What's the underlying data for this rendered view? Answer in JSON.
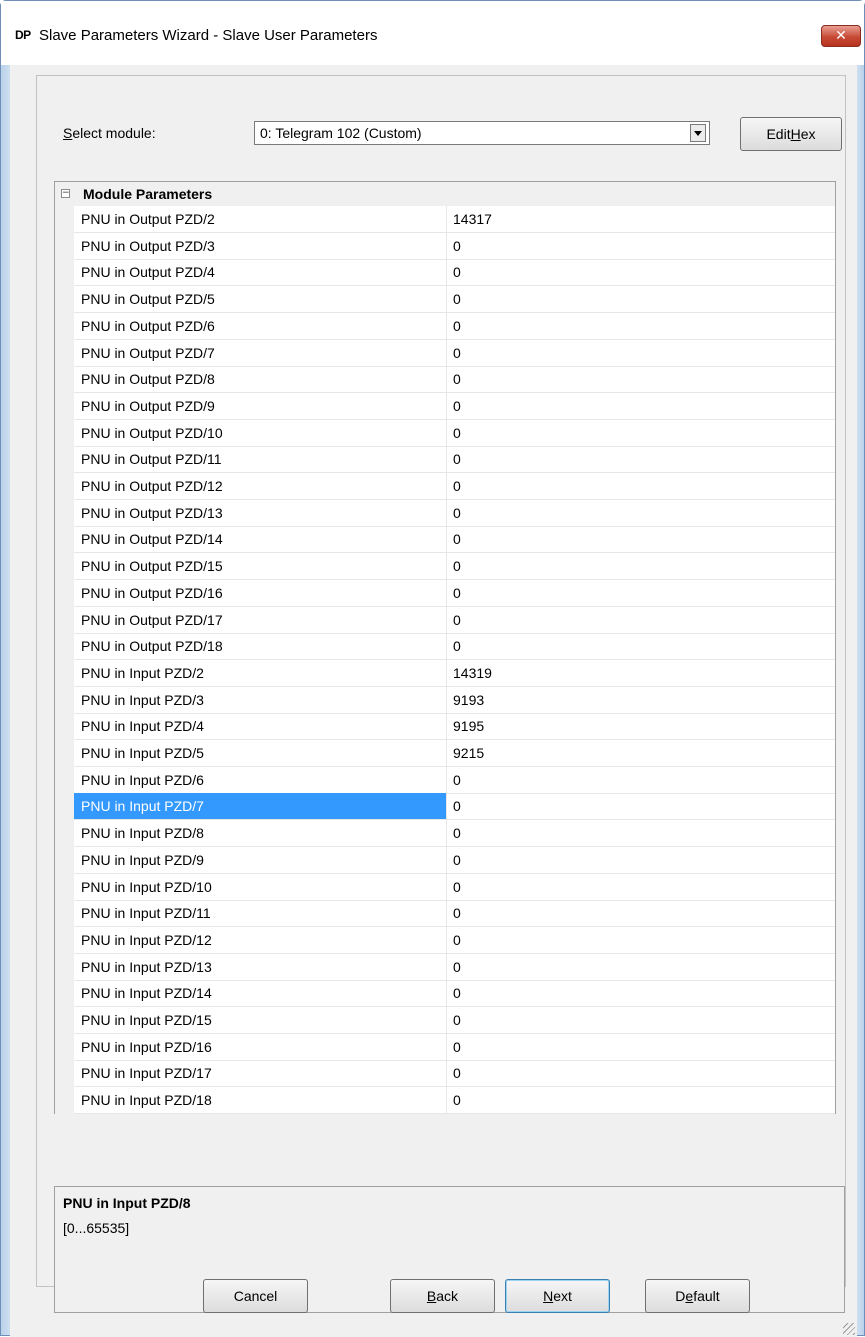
{
  "window": {
    "icon_text": "DP",
    "title": "Slave Parameters Wizard - Slave User Parameters"
  },
  "select_module": {
    "label": "Select module:",
    "value": "0: Telegram 102 (Custom)"
  },
  "buttons": {
    "edit_hex": "Edit Hex",
    "cancel": "Cancel",
    "back": "Back",
    "next": "Next",
    "default": "Default"
  },
  "grid": {
    "header": "Module Parameters",
    "selected_index": 22,
    "rows": [
      {
        "name": "PNU in Output PZD/2",
        "value": "14317"
      },
      {
        "name": "PNU in Output PZD/3",
        "value": "0"
      },
      {
        "name": "PNU in Output PZD/4",
        "value": "0"
      },
      {
        "name": "PNU in Output PZD/5",
        "value": "0"
      },
      {
        "name": "PNU in Output PZD/6",
        "value": "0"
      },
      {
        "name": "PNU in Output PZD/7",
        "value": "0"
      },
      {
        "name": "PNU in Output PZD/8",
        "value": "0"
      },
      {
        "name": "PNU in Output PZD/9",
        "value": "0"
      },
      {
        "name": "PNU in Output PZD/10",
        "value": "0"
      },
      {
        "name": "PNU in Output PZD/11",
        "value": "0"
      },
      {
        "name": "PNU in Output PZD/12",
        "value": "0"
      },
      {
        "name": "PNU in Output PZD/13",
        "value": "0"
      },
      {
        "name": "PNU in Output PZD/14",
        "value": "0"
      },
      {
        "name": "PNU in Output PZD/15",
        "value": "0"
      },
      {
        "name": "PNU in Output PZD/16",
        "value": "0"
      },
      {
        "name": "PNU in Output PZD/17",
        "value": "0"
      },
      {
        "name": "PNU in Output PZD/18",
        "value": "0"
      },
      {
        "name": "PNU in Input PZD/2",
        "value": "14319"
      },
      {
        "name": "PNU in Input PZD/3",
        "value": "9193"
      },
      {
        "name": "PNU in Input PZD/4",
        "value": "9195"
      },
      {
        "name": "PNU in Input PZD/5",
        "value": "9215"
      },
      {
        "name": "PNU in Input PZD/6",
        "value": "0"
      },
      {
        "name": "PNU in Input PZD/7",
        "value": "0"
      },
      {
        "name": "PNU in Input PZD/8",
        "value": "0"
      },
      {
        "name": "PNU in Input PZD/9",
        "value": "0"
      },
      {
        "name": "PNU in Input PZD/10",
        "value": "0"
      },
      {
        "name": "PNU in Input PZD/11",
        "value": "0"
      },
      {
        "name": "PNU in Input PZD/12",
        "value": "0"
      },
      {
        "name": "PNU in Input PZD/13",
        "value": "0"
      },
      {
        "name": "PNU in Input PZD/14",
        "value": "0"
      },
      {
        "name": "PNU in Input PZD/15",
        "value": "0"
      },
      {
        "name": "PNU in Input PZD/16",
        "value": "0"
      },
      {
        "name": "PNU in Input PZD/17",
        "value": "0"
      },
      {
        "name": "PNU in Input PZD/18",
        "value": "0"
      }
    ]
  },
  "info": {
    "title": "PNU in Input PZD/8",
    "range": "[0...65535]"
  },
  "colors": {
    "selection": "#3399ff",
    "close_button": "#c74a36"
  }
}
